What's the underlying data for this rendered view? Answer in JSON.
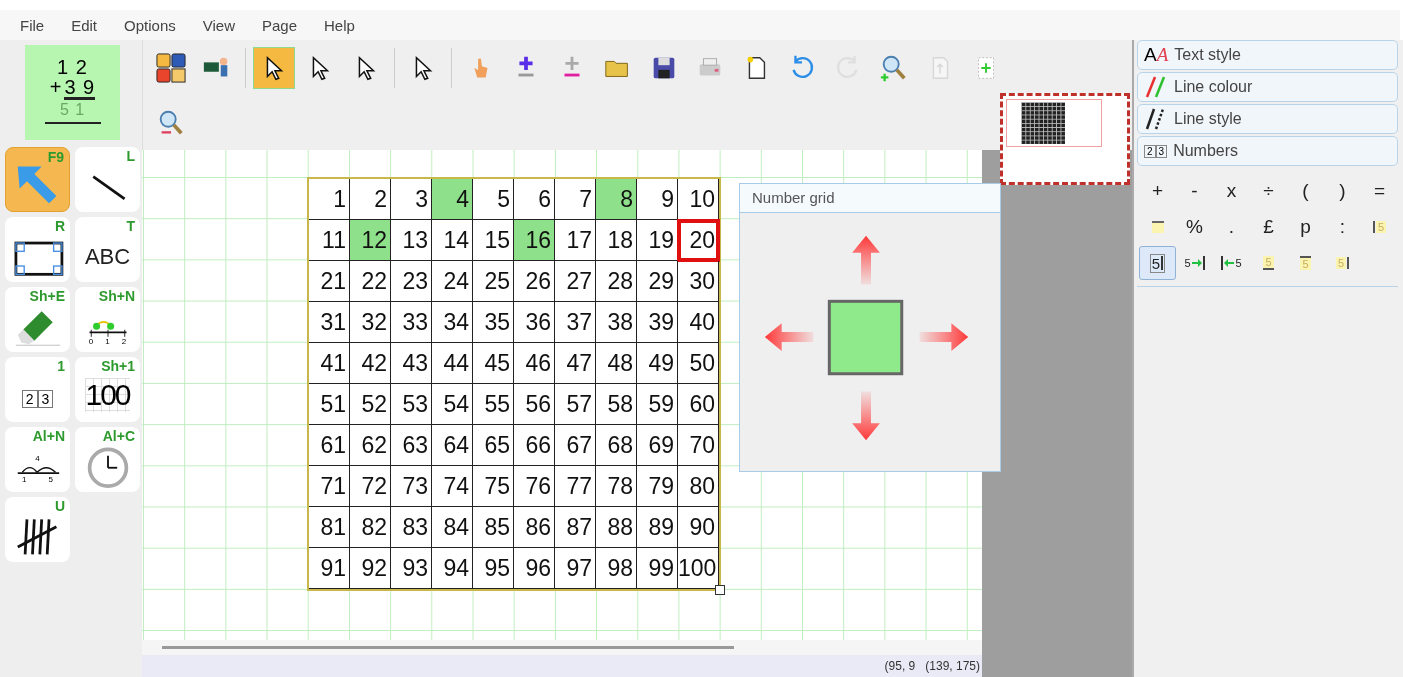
{
  "menu": [
    "File",
    "Edit",
    "Options",
    "View",
    "Page",
    "Help"
  ],
  "sum_card": {
    "top": "1 2",
    "operator": "+",
    "bottom": "3 9",
    "answer": "5 1"
  },
  "toolbar": {
    "groups": [
      [
        {
          "kind": "maths-tools",
          "selected": false,
          "disabled": false
        },
        {
          "kind": "teacher",
          "selected": false,
          "disabled": false
        }
      ],
      [
        {
          "kind": "select",
          "selected": true,
          "disabled": false
        },
        {
          "kind": "point-select",
          "selected": false,
          "disabled": false
        },
        {
          "kind": "angle-select",
          "selected": false,
          "disabled": false
        }
      ],
      [
        {
          "kind": "group-select",
          "selected": false,
          "disabled": false
        }
      ],
      [
        {
          "kind": "hand",
          "selected": false,
          "disabled": false
        },
        {
          "kind": "add",
          "selected": false,
          "disabled": false
        },
        {
          "kind": "subtract",
          "selected": false,
          "disabled": false
        },
        {
          "kind": "open",
          "selected": false,
          "disabled": false
        },
        {
          "kind": "save",
          "selected": false,
          "disabled": false
        },
        {
          "kind": "print",
          "selected": false,
          "disabled": false
        },
        {
          "kind": "new",
          "selected": false,
          "disabled": false
        },
        {
          "kind": "undo",
          "selected": false,
          "disabled": false
        },
        {
          "kind": "redo",
          "selected": false,
          "disabled": true
        },
        {
          "kind": "zoom-in",
          "selected": false,
          "disabled": false
        },
        {
          "kind": "page-up",
          "selected": false,
          "disabled": true
        },
        {
          "kind": "add-page",
          "selected": false,
          "disabled": false
        }
      ]
    ],
    "row2": [
      {
        "kind": "zoom-out",
        "selected": false,
        "disabled": false
      }
    ]
  },
  "tools": [
    {
      "kind": "arrow",
      "shortcut": "F9",
      "selected": true
    },
    {
      "kind": "line",
      "shortcut": "L",
      "selected": false
    },
    {
      "kind": "rectangle",
      "shortcut": "R",
      "selected": false
    },
    {
      "kind": "text",
      "shortcut": "T",
      "selected": false,
      "label": "ABC"
    },
    {
      "kind": "eraser",
      "shortcut": "Sh+E",
      "selected": false
    },
    {
      "kind": "number-line",
      "shortcut": "Sh+N",
      "selected": false,
      "ticks": [
        "0",
        "1",
        "2"
      ]
    },
    {
      "kind": "number-cards",
      "shortcut": "1",
      "selected": false,
      "ticks": [
        "2",
        "3"
      ]
    },
    {
      "kind": "hundred-square",
      "shortcut": "Sh+1",
      "selected": false,
      "label": "100"
    },
    {
      "kind": "jump-line",
      "shortcut": "Al+N",
      "selected": false,
      "label": "4",
      "ticks": [
        "1",
        "5"
      ]
    },
    {
      "kind": "clock",
      "shortcut": "Al+C",
      "selected": false
    },
    {
      "kind": "tally",
      "shortcut": "U",
      "selected": false
    }
  ],
  "number_grid": {
    "rows": [
      [
        {
          "text": "1",
          "highlighted": false,
          "selected": false
        },
        {
          "text": "2",
          "highlighted": false,
          "selected": false
        },
        {
          "text": "3",
          "highlighted": false,
          "selected": false
        },
        {
          "text": "4",
          "highlighted": true,
          "selected": false
        },
        {
          "text": "5",
          "highlighted": false,
          "selected": false
        },
        {
          "text": "6",
          "highlighted": false,
          "selected": false
        },
        {
          "text": "7",
          "highlighted": false,
          "selected": false
        },
        {
          "text": "8",
          "highlighted": true,
          "selected": false
        },
        {
          "text": "9",
          "highlighted": false,
          "selected": false
        },
        {
          "text": "10",
          "highlighted": false,
          "selected": false
        }
      ],
      [
        {
          "text": "11",
          "highlighted": false,
          "selected": false
        },
        {
          "text": "12",
          "highlighted": true,
          "selected": false
        },
        {
          "text": "13",
          "highlighted": false,
          "selected": false
        },
        {
          "text": "14",
          "highlighted": false,
          "selected": false
        },
        {
          "text": "15",
          "highlighted": false,
          "selected": false
        },
        {
          "text": "16",
          "highlighted": true,
          "selected": false
        },
        {
          "text": "17",
          "highlighted": false,
          "selected": false
        },
        {
          "text": "18",
          "highlighted": false,
          "selected": false
        },
        {
          "text": "19",
          "highlighted": false,
          "selected": false
        },
        {
          "text": "20",
          "highlighted": false,
          "selected": true
        }
      ],
      [
        {
          "text": "21",
          "highlighted": false,
          "selected": false
        },
        {
          "text": "22",
          "highlighted": false,
          "selected": false
        },
        {
          "text": "23",
          "highlighted": false,
          "selected": false
        },
        {
          "text": "24",
          "highlighted": false,
          "selected": false
        },
        {
          "text": "25",
          "highlighted": false,
          "selected": false
        },
        {
          "text": "26",
          "highlighted": false,
          "selected": false
        },
        {
          "text": "27",
          "highlighted": false,
          "selected": false
        },
        {
          "text": "28",
          "highlighted": false,
          "selected": false
        },
        {
          "text": "29",
          "highlighted": false,
          "selected": false
        },
        {
          "text": "30",
          "highlighted": false,
          "selected": false
        }
      ],
      [
        {
          "text": "31",
          "highlighted": false,
          "selected": false
        },
        {
          "text": "32",
          "highlighted": false,
          "selected": false
        },
        {
          "text": "33",
          "highlighted": false,
          "selected": false
        },
        {
          "text": "34",
          "highlighted": false,
          "selected": false
        },
        {
          "text": "35",
          "highlighted": false,
          "selected": false
        },
        {
          "text": "36",
          "highlighted": false,
          "selected": false
        },
        {
          "text": "37",
          "highlighted": false,
          "selected": false
        },
        {
          "text": "38",
          "highlighted": false,
          "selected": false
        },
        {
          "text": "39",
          "highlighted": false,
          "selected": false
        },
        {
          "text": "40",
          "highlighted": false,
          "selected": false
        }
      ],
      [
        {
          "text": "41",
          "highlighted": false,
          "selected": false
        },
        {
          "text": "42",
          "highlighted": false,
          "selected": false
        },
        {
          "text": "43",
          "highlighted": false,
          "selected": false
        },
        {
          "text": "44",
          "highlighted": false,
          "selected": false
        },
        {
          "text": "45",
          "highlighted": false,
          "selected": false
        },
        {
          "text": "46",
          "highlighted": false,
          "selected": false
        },
        {
          "text": "47",
          "highlighted": false,
          "selected": false
        },
        {
          "text": "48",
          "highlighted": false,
          "selected": false
        },
        {
          "text": "49",
          "highlighted": false,
          "selected": false
        },
        {
          "text": "50",
          "highlighted": false,
          "selected": false
        }
      ],
      [
        {
          "text": "51",
          "highlighted": false,
          "selected": false
        },
        {
          "text": "52",
          "highlighted": false,
          "selected": false
        },
        {
          "text": "53",
          "highlighted": false,
          "selected": false
        },
        {
          "text": "54",
          "highlighted": false,
          "selected": false
        },
        {
          "text": "55",
          "highlighted": false,
          "selected": false
        },
        {
          "text": "56",
          "highlighted": false,
          "selected": false
        },
        {
          "text": "57",
          "highlighted": false,
          "selected": false
        },
        {
          "text": "58",
          "highlighted": false,
          "selected": false
        },
        {
          "text": "59",
          "highlighted": false,
          "selected": false
        },
        {
          "text": "60",
          "highlighted": false,
          "selected": false
        }
      ],
      [
        {
          "text": "61",
          "highlighted": false,
          "selected": false
        },
        {
          "text": "62",
          "highlighted": false,
          "selected": false
        },
        {
          "text": "63",
          "highlighted": false,
          "selected": false
        },
        {
          "text": "64",
          "highlighted": false,
          "selected": false
        },
        {
          "text": "65",
          "highlighted": false,
          "selected": false
        },
        {
          "text": "66",
          "highlighted": false,
          "selected": false
        },
        {
          "text": "67",
          "highlighted": false,
          "selected": false
        },
        {
          "text": "68",
          "highlighted": false,
          "selected": false
        },
        {
          "text": "69",
          "highlighted": false,
          "selected": false
        },
        {
          "text": "70",
          "highlighted": false,
          "selected": false
        }
      ],
      [
        {
          "text": "71",
          "highlighted": false,
          "selected": false
        },
        {
          "text": "72",
          "highlighted": false,
          "selected": false
        },
        {
          "text": "73",
          "highlighted": false,
          "selected": false
        },
        {
          "text": "74",
          "highlighted": false,
          "selected": false
        },
        {
          "text": "75",
          "highlighted": false,
          "selected": false
        },
        {
          "text": "76",
          "highlighted": false,
          "selected": false
        },
        {
          "text": "77",
          "highlighted": false,
          "selected": false
        },
        {
          "text": "78",
          "highlighted": false,
          "selected": false
        },
        {
          "text": "79",
          "highlighted": false,
          "selected": false
        },
        {
          "text": "80",
          "highlighted": false,
          "selected": false
        }
      ],
      [
        {
          "text": "81",
          "highlighted": false,
          "selected": false
        },
        {
          "text": "82",
          "highlighted": false,
          "selected": false
        },
        {
          "text": "83",
          "highlighted": false,
          "selected": false
        },
        {
          "text": "84",
          "highlighted": false,
          "selected": false
        },
        {
          "text": "85",
          "highlighted": false,
          "selected": false
        },
        {
          "text": "86",
          "highlighted": false,
          "selected": false
        },
        {
          "text": "87",
          "highlighted": false,
          "selected": false
        },
        {
          "text": "88",
          "highlighted": false,
          "selected": false
        },
        {
          "text": "89",
          "highlighted": false,
          "selected": false
        },
        {
          "text": "90",
          "highlighted": false,
          "selected": false
        }
      ],
      [
        {
          "text": "91",
          "highlighted": false,
          "selected": false
        },
        {
          "text": "92",
          "highlighted": false,
          "selected": false
        },
        {
          "text": "93",
          "highlighted": false,
          "selected": false
        },
        {
          "text": "94",
          "highlighted": false,
          "selected": false
        },
        {
          "text": "95",
          "highlighted": false,
          "selected": false
        },
        {
          "text": "96",
          "highlighted": false,
          "selected": false
        },
        {
          "text": "97",
          "highlighted": false,
          "selected": false
        },
        {
          "text": "98",
          "highlighted": false,
          "selected": false
        },
        {
          "text": "99",
          "highlighted": false,
          "selected": false
        },
        {
          "text": "100",
          "highlighted": false,
          "selected": false
        }
      ]
    ]
  },
  "popup": {
    "title": "Number grid"
  },
  "side_panel": {
    "sections": [
      {
        "kind": "text-style",
        "label": "Text style",
        "icon_text": [
          "A",
          "A"
        ]
      },
      {
        "kind": "line-colour",
        "label": "Line colour"
      },
      {
        "kind": "line-style",
        "label": "Line style"
      },
      {
        "kind": "numbers",
        "label": "Numbers",
        "icon_text": [
          "2",
          "3"
        ]
      }
    ],
    "keys": [
      [
        {
          "kind": "char",
          "text": "+",
          "selected": false
        },
        {
          "kind": "char",
          "text": "-",
          "selected": false
        },
        {
          "kind": "char",
          "text": "x",
          "selected": false
        },
        {
          "kind": "char",
          "text": "÷",
          "selected": false
        },
        {
          "kind": "char",
          "text": "(",
          "selected": false
        },
        {
          "kind": "char",
          "text": ")",
          "selected": false
        },
        {
          "kind": "char",
          "text": "=",
          "selected": false
        }
      ],
      [
        {
          "kind": "bar-box",
          "selected": false
        },
        {
          "kind": "char",
          "text": "%",
          "selected": false
        },
        {
          "kind": "char",
          "text": ".",
          "selected": false
        },
        {
          "kind": "char",
          "text": "£",
          "selected": false
        },
        {
          "kind": "char",
          "text": "p",
          "selected": false
        },
        {
          "kind": "char",
          "text": ":",
          "selected": false
        },
        {
          "kind": "bar-left",
          "digit": "5",
          "selected": false
        }
      ],
      [
        {
          "kind": "cursor",
          "digit": "5",
          "selected": true
        },
        {
          "kind": "arrow-right",
          "digit": "5",
          "selected": false
        },
        {
          "kind": "arrow-left",
          "digit": "5",
          "selected": false
        },
        {
          "kind": "underline",
          "digit": "5",
          "selected": false
        },
        {
          "kind": "overline",
          "digit": "5",
          "selected": false
        },
        {
          "kind": "bar-right",
          "digit": "5",
          "selected": false
        }
      ]
    ]
  },
  "status": [
    "(95, 9",
    "(139, 175)"
  ]
}
